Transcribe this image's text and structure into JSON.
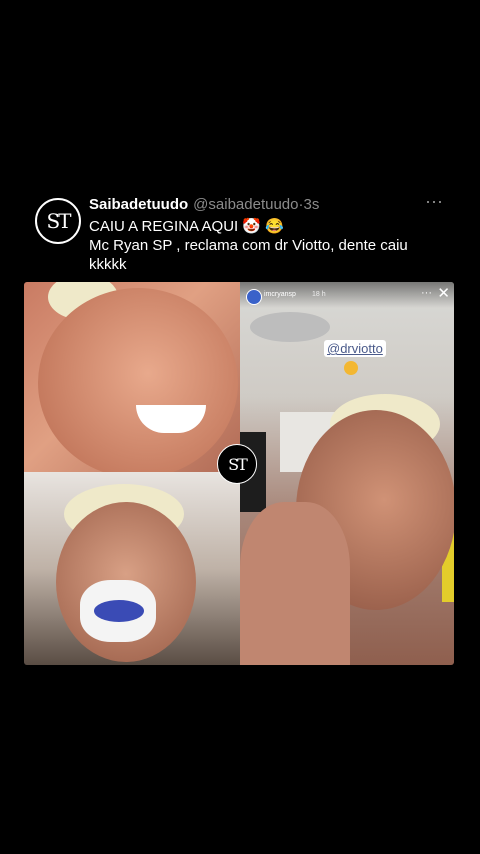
{
  "tweet": {
    "avatar_text": "ST",
    "display_name": "Saibadetuudo",
    "handle": "@saibadetuudo",
    "separator": "·",
    "time": "3s",
    "more_icon": "⋯",
    "lines": [
      "CAIU A REGINA AQUI 🤡 😂",
      "Mc Ryan SP , reclama com dr Viotto, dente caiu",
      "kkkkk"
    ]
  },
  "media": {
    "watermark_text": "ST",
    "story": {
      "username": "imcryansp",
      "time": "18 h",
      "more_icon": "···",
      "close_icon": "✕",
      "mention_sticker": "@drviotto"
    }
  }
}
